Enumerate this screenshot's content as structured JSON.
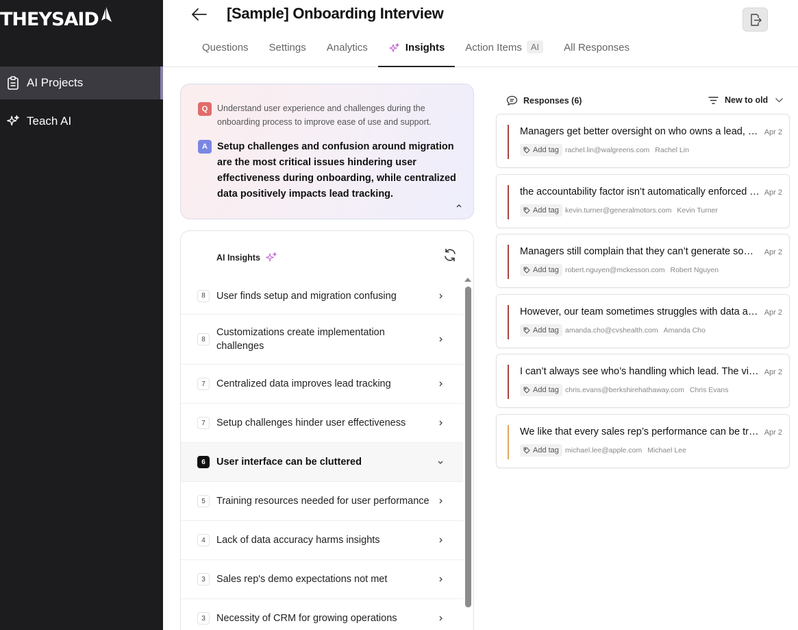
{
  "brand": {
    "logo_text": "THEYSAID"
  },
  "sidebar": {
    "items": [
      {
        "label": "AI Projects",
        "icon": "clipboard-icon",
        "active": true
      },
      {
        "label": "Teach AI",
        "icon": "sparkles-icon",
        "active": false
      }
    ]
  },
  "header": {
    "title": "[Sample] Onboarding Interview",
    "tabs": [
      {
        "label": "Questions"
      },
      {
        "label": "Settings"
      },
      {
        "label": "Analytics"
      },
      {
        "label": "Insights",
        "active": true
      },
      {
        "label": "Action Items",
        "badge": "AI"
      },
      {
        "label": "All Responses"
      }
    ]
  },
  "summary": {
    "q_badge": "Q",
    "question": "Understand user experience and challenges during the onboarding process to improve ease of use and support.",
    "a_badge": "A",
    "answer": "Setup challenges and confusion around migration are the most critical issues hindering user effectiveness during onboarding, while centralized data positively impacts lead tracking."
  },
  "insights": {
    "title": "AI Insights",
    "items": [
      {
        "count": "8",
        "label": "User finds setup and migration confusing"
      },
      {
        "count": "8",
        "label": "Customizations create implementation challenges"
      },
      {
        "count": "7",
        "label": "Centralized data improves lead tracking"
      },
      {
        "count": "7",
        "label": "Setup challenges hinder user effectiveness"
      },
      {
        "count": "6",
        "label": "User interface can be cluttered",
        "expanded": true
      },
      {
        "count": "5",
        "label": "Training resources needed for user performance"
      },
      {
        "count": "4",
        "label": "Lack of data accuracy harms insights"
      },
      {
        "count": "3",
        "label": "Sales rep's demo expectations not met"
      },
      {
        "count": "3",
        "label": "Necessity of CRM for growing operations"
      }
    ]
  },
  "responses": {
    "title": "Responses (6)",
    "sort_label": "New to old",
    "add_tag_label": "Add tag",
    "items": [
      {
        "text": "Managers get better oversight on who owns a lead, which is great.",
        "date": "Apr 2",
        "email": "rachel.lin@walgreens.com",
        "name": "Rachel Lin",
        "sentiment_color": "#a8453c"
      },
      {
        "text": "the accountability factor isn’t automatically enforced by the system.",
        "date": "Apr 2",
        "email": "kevin.turner@generalmotors.com",
        "name": "Kevin Turner",
        "sentiment_color": "#a8453c"
      },
      {
        "text": "Managers still complain that they can’t generate some of the reports they need.",
        "date": "Apr 2",
        "email": "robert.nguyen@mckesson.com",
        "name": "Robert Nguyen",
        "sentiment_color": "#a8453c"
      },
      {
        "text": "However, our team sometimes struggles with data accuracy.",
        "date": "Apr 2",
        "email": "amanda.cho@cvshealth.com",
        "name": "Amanda Cho",
        "sentiment_color": "#a8453c"
      },
      {
        "text": "I can’t always see who’s handling which lead. The visibility could be better.",
        "date": "Apr 2",
        "email": "chris.evans@berkshirehathaway.com",
        "name": "Chris Evans",
        "sentiment_color": "#a8453c"
      },
      {
        "text": "We like that every sales rep’s performance can be tracked in one place.",
        "date": "Apr 2",
        "email": "michael.lee@apple.com",
        "name": "Michael Lee",
        "sentiment_color": "#e2a65a"
      }
    ]
  }
}
